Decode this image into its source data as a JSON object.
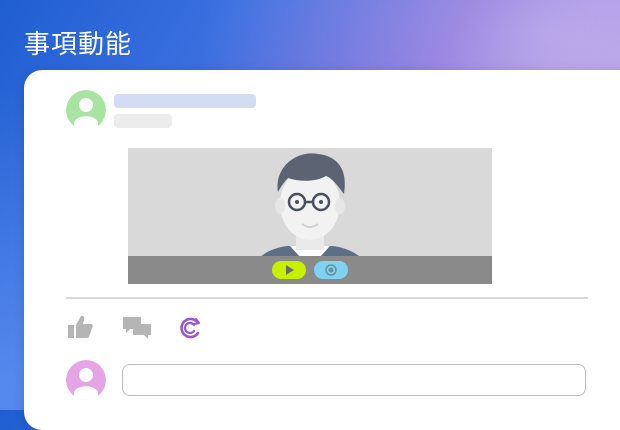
{
  "app": {
    "title": "事項動能"
  },
  "post": {
    "author_avatar": "user-avatar-green",
    "author_name_placeholder": "",
    "timestamp_placeholder": "",
    "media": {
      "type": "video",
      "controls": [
        "play-button",
        "record-button"
      ]
    }
  },
  "actions": {
    "items": [
      "thumbs-up-icon",
      "comment-bubbles-icon",
      "share-sync-icon"
    ]
  },
  "comment": {
    "avatar": "user-avatar-pink",
    "input_value": "",
    "input_placeholder": ""
  },
  "colors": {
    "title_text": "#ffffff",
    "avatar_green": "#a6e4a0",
    "avatar_pink": "#e6a3e6",
    "name_placeholder": "#d3dcf3",
    "time_placeholder": "#ececec",
    "play_button": "#c6f000",
    "record_button": "#7fd3f0",
    "action_icon_gray": "#b5b5b5",
    "share_icon_purple": "#9a56d8"
  }
}
